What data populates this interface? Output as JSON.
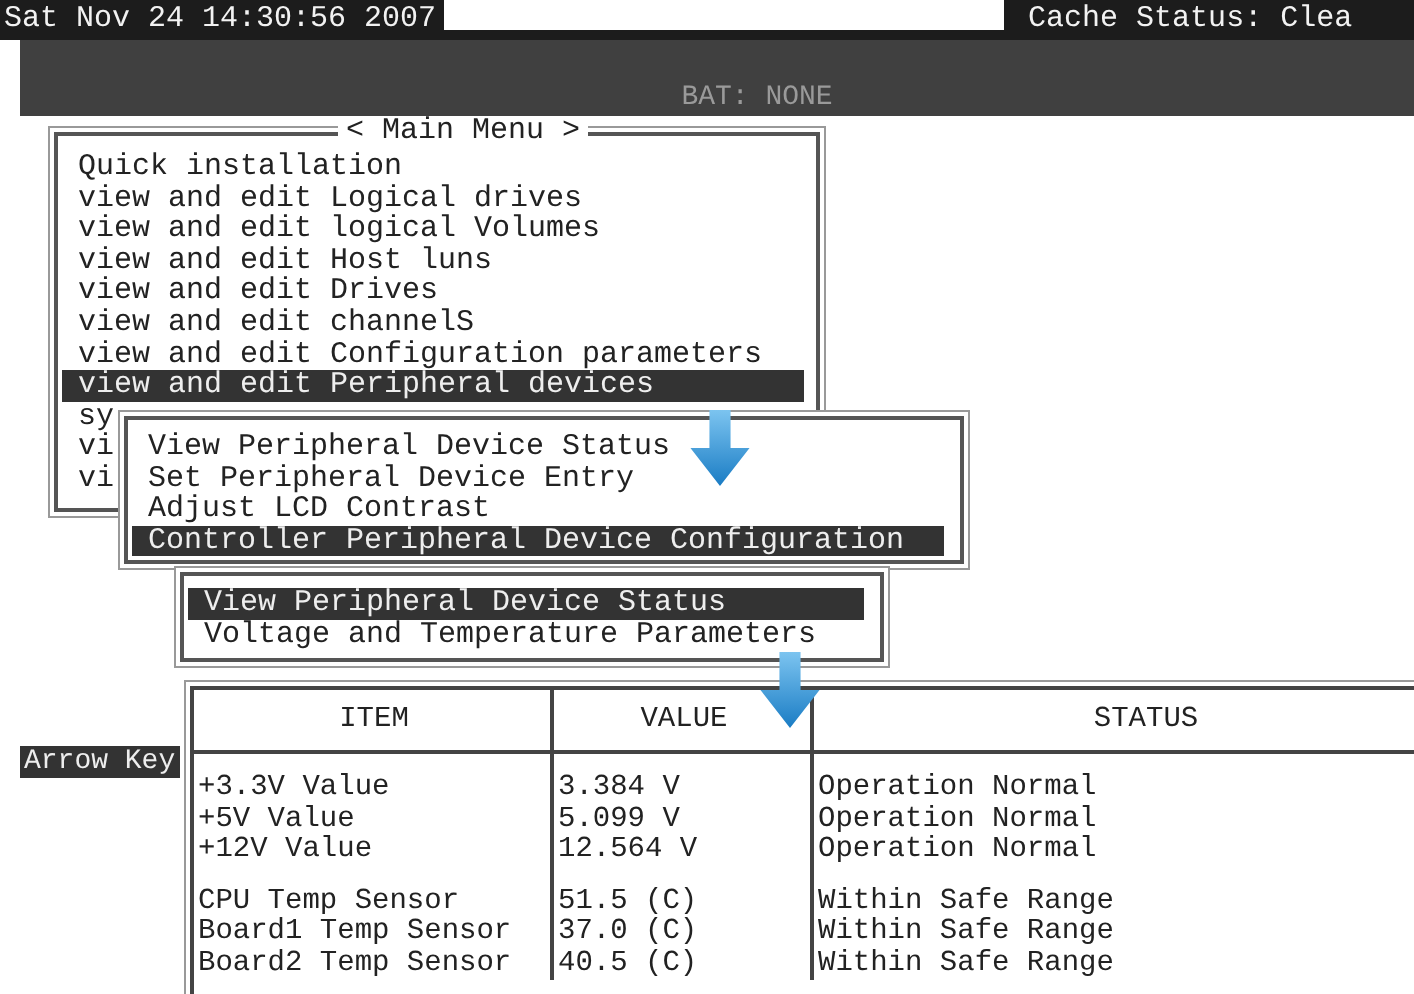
{
  "clock": "Sat Nov 24 14:30:56 2007",
  "cache_status": "Cache Status: Clea",
  "battery": "BAT: NONE",
  "main_menu": {
    "title": "< Main Menu >",
    "items": [
      {
        "label": "Quick installation",
        "selected": false
      },
      {
        "label": "view and edit Logical drives",
        "selected": false
      },
      {
        "label": "view and edit logical Volumes",
        "selected": false
      },
      {
        "label": "view and edit Host luns",
        "selected": false
      },
      {
        "label": "view and edit Drives",
        "selected": false
      },
      {
        "label": "view and edit channelS",
        "selected": false
      },
      {
        "label": "view and edit Configuration parameters",
        "selected": false
      },
      {
        "label": "view and edit Peripheral devices",
        "selected": true
      },
      {
        "label": "sy",
        "selected": false
      },
      {
        "label": "vi",
        "selected": false
      },
      {
        "label": "vi",
        "selected": false
      }
    ]
  },
  "peripheral_menu": {
    "items": [
      {
        "label": "View Peripheral Device Status",
        "selected": false
      },
      {
        "label": "Set Peripheral Device Entry",
        "selected": false
      },
      {
        "label": "Adjust LCD Contrast",
        "selected": false
      },
      {
        "label": "Controller Peripheral Device Configuration",
        "selected": true
      }
    ]
  },
  "configuration_menu": {
    "items": [
      {
        "label": "View Peripheral Device Status",
        "selected": true
      },
      {
        "label": "Voltage and Temperature Parameters",
        "selected": false
      }
    ]
  },
  "hint": "Arrow Key",
  "table": {
    "columns": [
      "ITEM",
      "VALUE",
      "STATUS"
    ],
    "groups": [
      [
        {
          "item": "+3.3V Value",
          "value": "3.384 V",
          "status": "Operation Normal"
        },
        {
          "item": "+5V Value",
          "value": "5.099 V",
          "status": "Operation Normal"
        },
        {
          "item": "+12V Value",
          "value": "12.564 V",
          "status": "Operation Normal"
        }
      ],
      [
        {
          "item": "CPU Temp Sensor",
          "value": "51.5 (C)",
          "status": "Within Safe Range"
        },
        {
          "item": "Board1 Temp Sensor",
          "value": "37.0 (C)",
          "status": "Within Safe Range"
        },
        {
          "item": "Board2 Temp Sensor",
          "value": "40.5 (C)",
          "status": "Within Safe Range"
        }
      ]
    ]
  }
}
